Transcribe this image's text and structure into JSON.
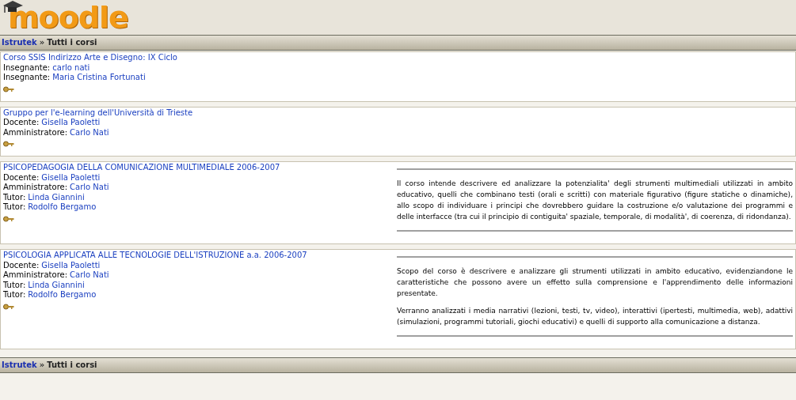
{
  "header": {
    "logo": "moodle"
  },
  "breadcrumb_top": {
    "home": "Istrutek",
    "separator": "»",
    "current": "Tutti i corsi"
  },
  "courses": [
    {
      "name": "Corso SSIS Indirizzo Arte e Disegno: IX Ciclo",
      "staff": [
        {
          "role": "Insegnante:",
          "name": "carlo nati"
        },
        {
          "role": "Insegnante:",
          "name": "Maria Cristina Fortunati"
        }
      ]
    },
    {
      "name": "Gruppo per l'e-learning dell'Università di Trieste",
      "staff": [
        {
          "role": "Docente:",
          "name": "Gisella Paoletti"
        },
        {
          "role": "Amministratore:",
          "name": "Carlo Nati"
        }
      ]
    },
    {
      "name": "PSICOPEDAGOGIA DELLA COMUNICAZIONE MULTIMEDIALE 2006-2007",
      "staff": [
        {
          "role": "Docente:",
          "name": "Gisella Paoletti"
        },
        {
          "role": "Amministratore:",
          "name": "Carlo Nati"
        },
        {
          "role": "Tutor:",
          "name": "Linda Giannini"
        },
        {
          "role": "Tutor:",
          "name": "Rodolfo Bergamo"
        }
      ],
      "summary": [
        "Il corso intende descrivere ed analizzare la potenzialita' degli strumenti multimediali utilizzati in ambito educativo, quelli che combinano testi (orali e scritti) con materiale figurativo (figure statiche o dinamiche), allo scopo di individuare i principi che dovrebbero guidare la costruzione e/o valutazione dei programmi e delle interfacce (tra cui il principio di contiguita' spaziale, temporale, di modalità', di coerenza, di ridondanza)."
      ]
    },
    {
      "name": "PSICOLOGIA APPLICATA ALLE TECNOLOGIE DELL'ISTRUZIONE a.a. 2006-2007",
      "staff": [
        {
          "role": "Docente:",
          "name": "Gisella Paoletti"
        },
        {
          "role": "Amministratore:",
          "name": "Carlo Nati"
        },
        {
          "role": "Tutor:",
          "name": "Linda Giannini"
        },
        {
          "role": "Tutor:",
          "name": "Rodolfo Bergamo"
        }
      ],
      "summary": [
        "Scopo del corso è descrivere e analizzare gli strumenti utilizzati in ambito educativo, evidenziandone le caratteristiche che possono avere un effetto sulla comprensione e l'apprendimento delle informazioni presentate.",
        "Verranno analizzati i media narrativi (lezioni, testi, tv, video), interattivi (ipertesti, multimedia, web), adattivi (simulazioni, programmi tutoriali, giochi educativi) e quelli di supporto alla comunicazione a distanza."
      ]
    }
  ],
  "breadcrumb_bottom": {
    "home": "Istrutek",
    "separator": "»",
    "current": "Tutti i corsi"
  }
}
